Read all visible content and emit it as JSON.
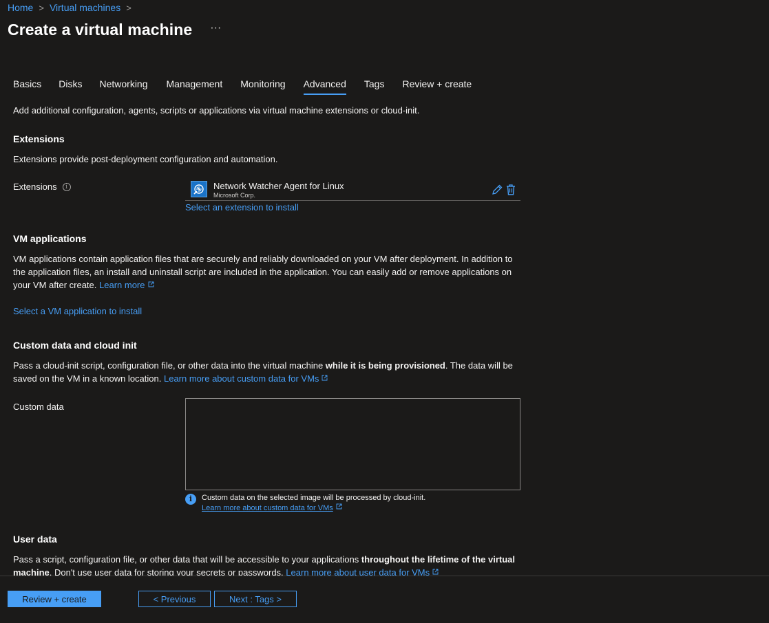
{
  "breadcrumb": {
    "home": "Home",
    "virtual_machines": "Virtual machines",
    "sep": ">"
  },
  "page": {
    "title": "Create a virtual machine",
    "more": "···"
  },
  "tabs": [
    {
      "label": "Basics"
    },
    {
      "label": "Disks"
    },
    {
      "label": "Networking"
    },
    {
      "label": "Management"
    },
    {
      "label": "Monitoring"
    },
    {
      "label": "Advanced",
      "active": true
    },
    {
      "label": "Tags"
    },
    {
      "label": "Review + create"
    }
  ],
  "intro": "Add additional configuration, agents, scripts or applications via virtual machine extensions or cloud-init.",
  "extensions": {
    "section_title": "Extensions",
    "description": "Extensions provide post-deployment configuration and automation.",
    "field_label": "Extensions",
    "item": {
      "name": "Network Watcher Agent for Linux",
      "publisher": "Microsoft Corp."
    },
    "select_link": "Select an extension to install"
  },
  "vm_apps": {
    "section_title": "VM applications",
    "description": "VM applications contain application files that are securely and reliably downloaded on your VM after deployment. In addition to the application files, an install and uninstall script are included in the application. You can easily add or remove applications on your VM after create.",
    "learn_more": "Learn more",
    "select_link": "Select a VM application to install"
  },
  "custom_data": {
    "section_title": "Custom data and cloud init",
    "desc_before": "Pass a cloud-init script, configuration file, or other data into the virtual machine ",
    "desc_bold": "while it is being provisioned",
    "desc_after": ". The data will be saved on the VM in a known location.",
    "learn_more": "Learn more about custom data for VMs",
    "field_label": "Custom data",
    "value": "",
    "info_text": "Custom data on the selected image will be processed by cloud-init.",
    "info_link": "Learn more about custom data for VMs"
  },
  "user_data": {
    "section_title": "User data",
    "desc_before": "Pass a script, configuration file, or other data that will be accessible to your applications ",
    "desc_bold": "throughout the lifetime of the virtual machine",
    "desc_after": ". Don't use user data for storing your secrets or passwords.",
    "learn_more": "Learn more about user data for VMs"
  },
  "footer": {
    "review_create": "Review + create",
    "previous": "< Previous",
    "next": "Next : Tags >"
  },
  "colors": {
    "background": "#1b1a19",
    "accent": "#479ef5",
    "text": "#f3f2f1"
  }
}
